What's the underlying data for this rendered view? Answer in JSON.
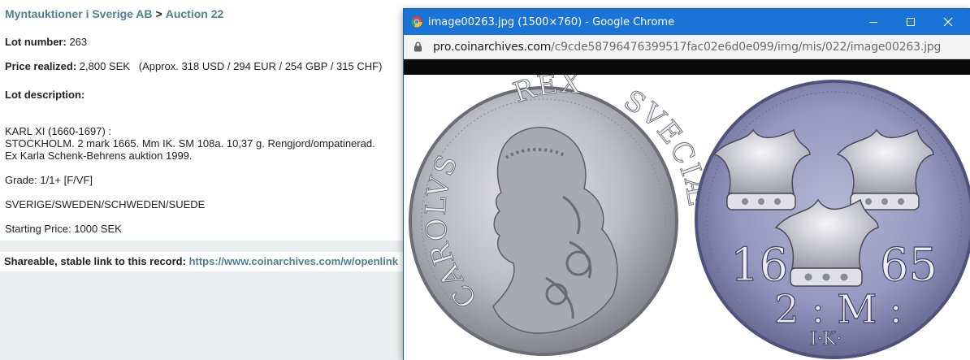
{
  "breadcrumb": {
    "house": "Myntauktioner i Sverige AB",
    "separator": ">",
    "auction": "Auction 22"
  },
  "lot": {
    "number_label": "Lot number:",
    "number": "263",
    "price_label": "Price realized:",
    "price": "2,800 SEK",
    "approx": "(Approx. 318 USD / 294 EUR / 254 GBP / 315 CHF)",
    "description_label": "Lot description:",
    "desc_line1": "KARL XI (1660-1697) :",
    "desc_line2": "STOCKHOLM. 2 mark 1665. Mm IK. SM 108a. 10,37 g. Rengjord/ompatinerad.",
    "desc_line3": "Ex Karla Schenk-Behrens auktion 1999.",
    "grade": "Grade: 1/1+ [F/VF]",
    "country": "SVERIGE/SWEDEN/SCHWEDEN/SUEDE",
    "starting_price": "Starting Price: 1000 SEK"
  },
  "share": {
    "label": "Shareable, stable link to this record:",
    "url": "https://www.coinarchives.com/w/openlink"
  },
  "popup": {
    "title": "image00263.jpg (1500×760) - Google Chrome",
    "url_host": "pro.coinarchives.com",
    "url_path": "/c9cde58796476399517fac02e6d0e099/img/mis/022/image00263.jpg"
  },
  "coin": {
    "obverse_legend_left": "CAROLVS",
    "obverse_legend_top": "REX",
    "obverse_legend_right": "SVECIÆ",
    "reverse_year_left": "16",
    "reverse_year_right": "65",
    "reverse_denomination": "2 : M :",
    "reverse_mintmark": "I·K·"
  },
  "colors": {
    "link": "#4f7f92",
    "titlebar": "#1a73d6",
    "silver": "#c9c9cf",
    "toned": "#9c9fc2"
  }
}
